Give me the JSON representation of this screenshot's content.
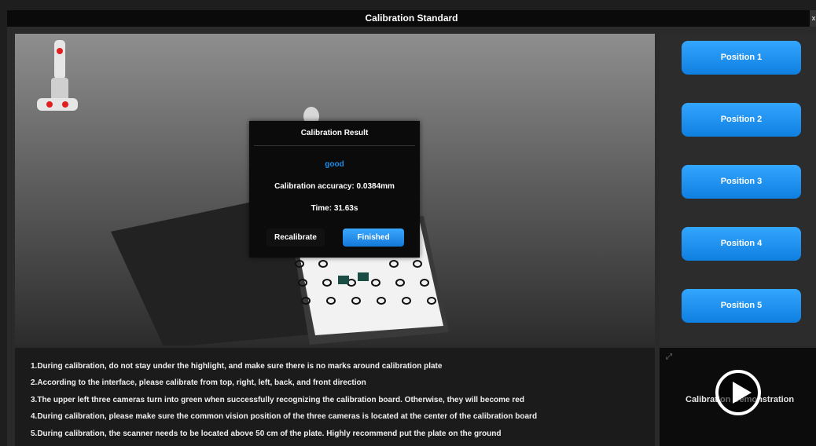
{
  "window": {
    "title": "Calibration Standard",
    "close_label": "x"
  },
  "positions": [
    "Position 1",
    "Position 2",
    "Position 3",
    "Position 4",
    "Position 5"
  ],
  "dialog": {
    "title": "Calibration Result",
    "status": "good",
    "accuracy": "Calibration accuracy: 0.0384mm",
    "time": "Time: 31.63s",
    "recalibrate_label": "Recalibrate",
    "finished_label": "Finished"
  },
  "instructions": [
    "1.During calibration, do not stay under the highlight, and make sure there is no marks around calibration plate",
    "2.According to the interface, please calibrate from top, right, left, back, and front direction",
    "3.The upper left three cameras turn into green when successfully recognizing the calibration board. Otherwise, they will become red",
    "4.During calibration, please make sure the common vision position of the three cameras is located at the center of the calibration board",
    "5.During calibration, the scanner needs to be located above 50 cm of the plate. Highly recommend put the plate on the ground"
  ],
  "demo": {
    "label": "Calibration Demonstration"
  },
  "colors": {
    "accent": "#1e8ee8",
    "camera_status": "#e02020"
  },
  "icons": {
    "play": "play-icon",
    "expand": "expand-icon",
    "scanner": "scanner-icon"
  }
}
